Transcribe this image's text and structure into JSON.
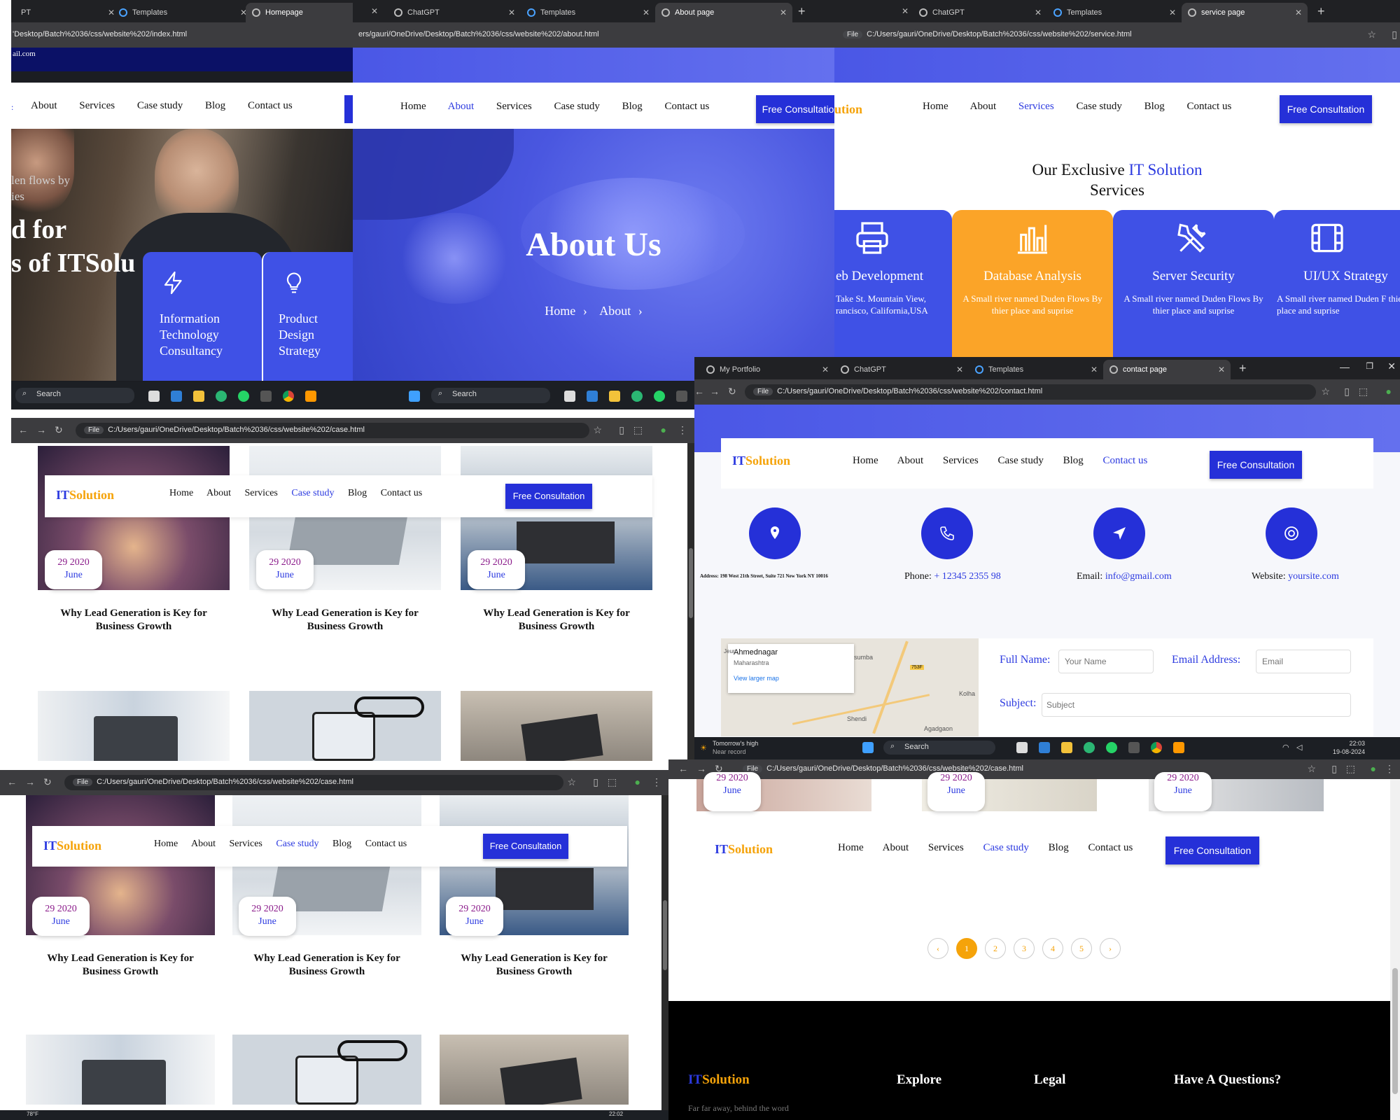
{
  "home": {
    "tabs": [
      "PT",
      "Templates",
      "Homepage"
    ],
    "url": "'Desktop/Batch%2036/css/website%202/index.html",
    "email_fragment": "ail.com",
    "nav": [
      "About",
      "Services",
      "Case study",
      "Blog",
      "Contact us"
    ],
    "hero_small": [
      "len flows by",
      "ies"
    ],
    "hero_big_1": "d for",
    "hero_big_2": "s of ITSolu",
    "card1": "Information Technology Consultancy",
    "card2": "Product Design Strategy",
    "taskbar_search": "Search"
  },
  "about": {
    "tabs": [
      "ChatGPT",
      "Templates",
      "About page"
    ],
    "url": "ers/gauri/OneDrive/Desktop/Batch%2036/css/website%202/about.html",
    "nav": [
      "Home",
      "About",
      "Services",
      "Case study",
      "Blog",
      "Contact us"
    ],
    "active": "About",
    "button": "Free Consultatio",
    "title": "About Us",
    "crumb1": "Home",
    "crumb2": "About",
    "taskbar_search": "Search"
  },
  "service": {
    "tabs": [
      "ChatGPT",
      "Templates",
      "service page"
    ],
    "url": "C:/Users/gauri/OneDrive/Desktop/Batch%2036/css/website%202/service.html",
    "file": "File",
    "logo_fragment": "ution",
    "nav": [
      "Home",
      "About",
      "Services",
      "Case study",
      "Blog",
      "Contact us"
    ],
    "button": "Free Consultation",
    "heading_pre": "Our Exclusive ",
    "heading_hl": "IT Solution",
    "heading_post": "Services",
    "cards": [
      {
        "title": "eb Development",
        "desc": "Take St. Mountain View, rancisco, California,USA"
      },
      {
        "title": "Database Analysis",
        "desc": "A Small river named Duden Flows By thier place and suprise"
      },
      {
        "title": "Server Security",
        "desc": "A Small river named Duden Flows By thier place and suprise"
      },
      {
        "title": "UI/UX Strategy",
        "desc": "A Small river named Duden F thier place and suprise"
      }
    ]
  },
  "contact": {
    "tabs": [
      "My Portfolio",
      "ChatGPT",
      "Templates",
      "contact page"
    ],
    "url": "C:/Users/gauri/OneDrive/Desktop/Batch%2036/css/website%202/contact.html",
    "file": "File",
    "logo_it": "IT",
    "logo_sol": "Solution",
    "nav": [
      "Home",
      "About",
      "Services",
      "Case study",
      "Blog",
      "Contact us"
    ],
    "button": "Free Consultation",
    "address": "Address: 198 West 21th Street, Suite 721 New York NY 10016",
    "phone_label": "Phone: ",
    "phone": "+ 12345 2355 98",
    "email_label": "Email: ",
    "email": "info@gmail.com",
    "website_label": "Website: ",
    "website": "yoursite.com",
    "map_place": "Ahmednagar",
    "map_region": "Maharashtra",
    "map_link": "View larger map",
    "map_labels": [
      "Jeur",
      "sumba",
      "Kolha",
      "Shendi",
      "Agadgaon",
      "753F"
    ],
    "form": {
      "name_label": "Full Name:",
      "name_ph": "Your Name",
      "email_label": "Email Address:",
      "email_ph": "Email",
      "subject_label": "Subject:",
      "subject_ph": "Subject"
    },
    "weather": "Tomorrow's high",
    "weather_sub": "Near record",
    "taskbar_search": "Search",
    "time": "22:03",
    "date": "19-08-2024"
  },
  "case_a": {
    "url": "C:/Users/gauri/OneDrive/Desktop/Batch%2036/css/website%202/case.html",
    "file": "File",
    "logo_it": "IT",
    "logo_sol": "Solution",
    "nav": [
      "Home",
      "About",
      "Services",
      "Case study",
      "Blog",
      "Contact us"
    ],
    "button": "Free Consultation",
    "date_day": "29 2020",
    "date_month": "June",
    "card_title": "Why Lead Generation is Key for Business Growth"
  },
  "case_b": {
    "url": "C:/Users/gauri/OneDrive/Desktop/Batch%2036/css/website%202/case.html",
    "file": "File",
    "logo_it": "IT",
    "logo_sol": "Solution",
    "nav": [
      "Home",
      "About",
      "Services",
      "Case study",
      "Blog",
      "Contact us"
    ],
    "button": "Free Consultation",
    "date_day": "29 2020",
    "date_month": "June",
    "card_title": "Why Lead Generation is Key for Business Growth",
    "weather": "78°F",
    "time": "22:02"
  },
  "case_c": {
    "url": "C:/Users/gauri/OneDrive/Desktop/Batch%2036/css/website%202/case.html",
    "file": "File",
    "date_day": "29 2020",
    "date_month": "June",
    "logo_it": "IT",
    "logo_sol": "Solution",
    "nav": [
      "Home",
      "About",
      "Services",
      "Case study",
      "Blog",
      "Contact us"
    ],
    "button": "Free Consultation",
    "pages": [
      "‹",
      "1",
      "2",
      "3",
      "4",
      "5",
      "›"
    ],
    "footer_logo_it": "IT",
    "footer_logo_sol": "Solution",
    "footer_cols": [
      "Explore",
      "Legal",
      "Have A Questions?"
    ],
    "footer_text": "Far far away, behind the word"
  },
  "colors": {
    "primary": "#2530d8",
    "accent": "#f5a30a",
    "card_blue": "#3f51e6"
  }
}
